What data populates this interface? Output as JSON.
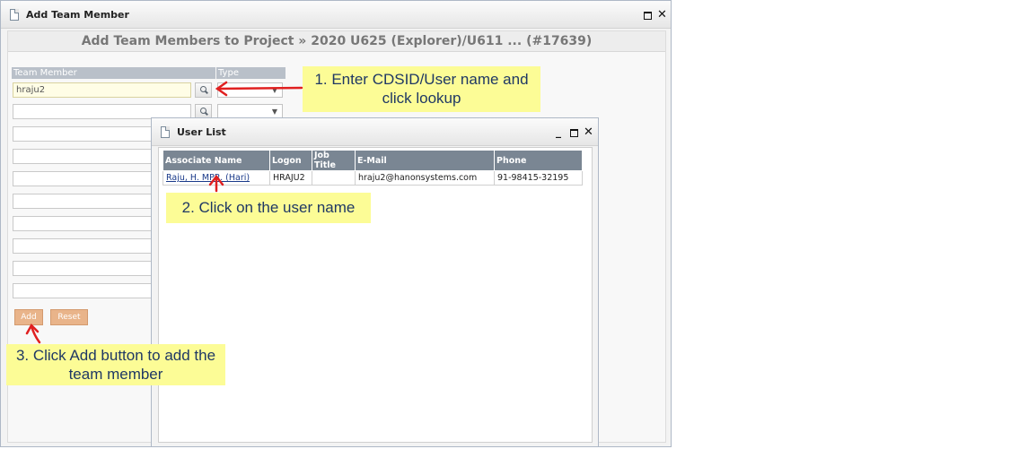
{
  "window": {
    "title": "Add Team Member"
  },
  "form": {
    "header": "Add Team Members to Project » 2020 U625 (Explorer)/U611 ... (#17639)",
    "columns": {
      "member": "Team Member",
      "type": "Type"
    },
    "first_value": "hraju2",
    "add_label": "Add",
    "reset_label": "Reset"
  },
  "dialog": {
    "title": "User List",
    "columns": [
      "Associate Name",
      "Logon",
      "Job Title",
      "E-Mail",
      "Phone"
    ],
    "rows": [
      {
        "name": "Raju, H. MPR. (Hari)",
        "logon": "HRAJU2",
        "job_title": "",
        "email": "hraju2@hanonsystems.com",
        "phone": "91-98415-32195"
      }
    ]
  },
  "annotations": {
    "step1_line1": "1. Enter CDSID/User name and",
    "step1_line2": "click lookup",
    "step2": "2. Click on the user name",
    "step3_line1": "3. Click Add button to add the",
    "step3_line2": "team member"
  },
  "colors": {
    "note_bg": "#fcfc96",
    "note_text": "#1f3864",
    "arrow": "#e02020",
    "button": "#e9b48a",
    "table_header": "#7a8693"
  },
  "icons": [
    "document-icon",
    "maximize-icon",
    "minimize-icon",
    "close-icon",
    "search-icon",
    "dropdown-arrow-icon"
  ]
}
